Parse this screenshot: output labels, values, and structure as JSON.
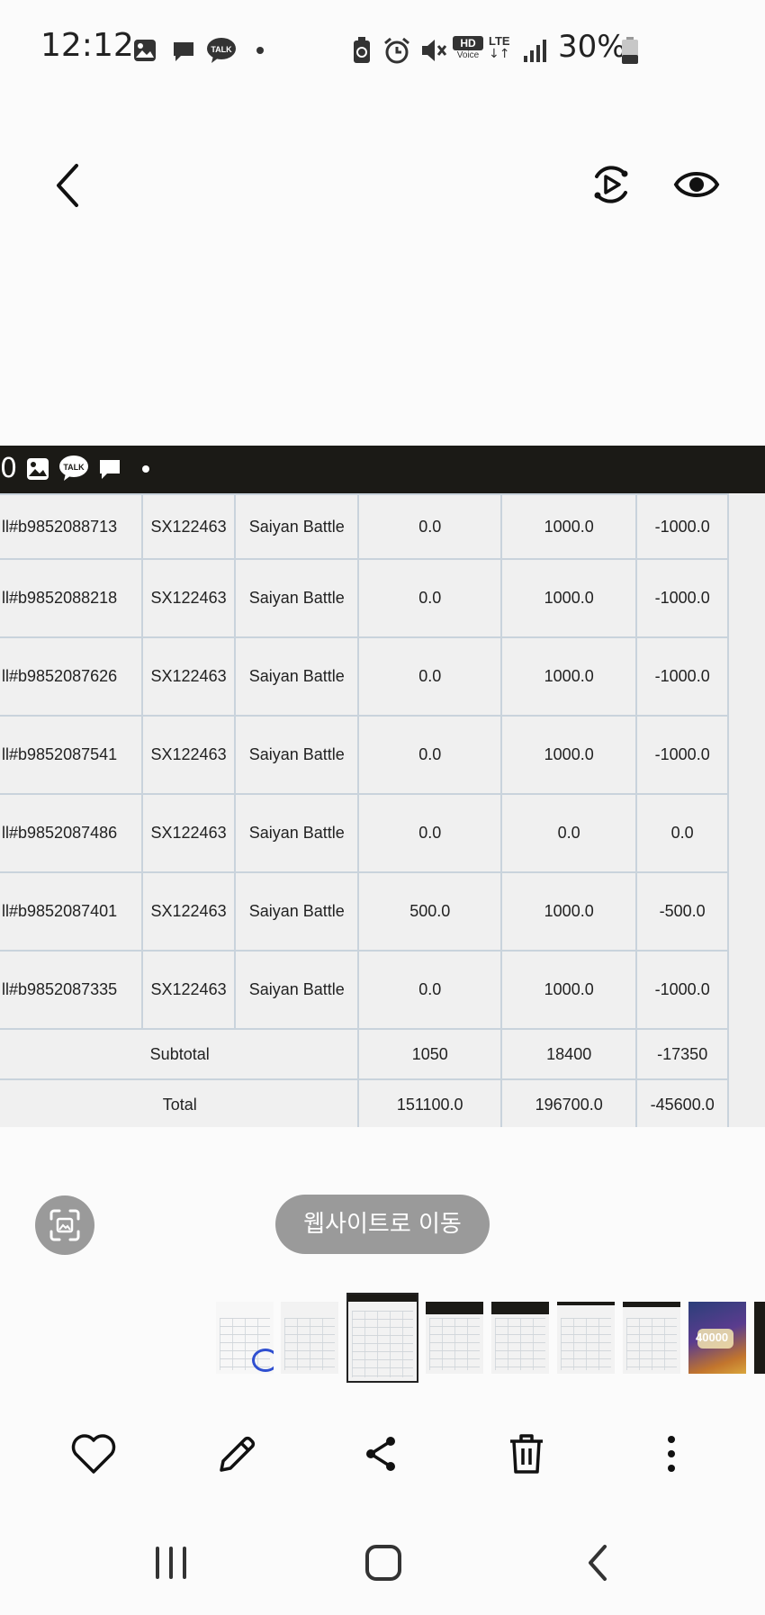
{
  "status_bar": {
    "time": "12:12",
    "battery": "30%",
    "hd_label": "HD",
    "voice_label": "Voice",
    "lte_label": "LTE"
  },
  "screenshot": {
    "status_text": "0",
    "rows": [
      {
        "id": "ll#b9852088713",
        "code": "SX122463",
        "game": "Saiyan Battle",
        "a": "0.0",
        "b": "1000.0",
        "c": "-1000.0"
      },
      {
        "id": "ll#b9852088218",
        "code": "SX122463",
        "game": "Saiyan Battle",
        "a": "0.0",
        "b": "1000.0",
        "c": "-1000.0"
      },
      {
        "id": "ll#b9852087626",
        "code": "SX122463",
        "game": "Saiyan Battle",
        "a": "0.0",
        "b": "1000.0",
        "c": "-1000.0"
      },
      {
        "id": "ll#b9852087541",
        "code": "SX122463",
        "game": "Saiyan Battle",
        "a": "0.0",
        "b": "1000.0",
        "c": "-1000.0"
      },
      {
        "id": "ll#b9852087486",
        "code": "SX122463",
        "game": "Saiyan Battle",
        "a": "0.0",
        "b": "0.0",
        "c": "0.0"
      },
      {
        "id": "ll#b9852087401",
        "code": "SX122463",
        "game": "Saiyan Battle",
        "a": "500.0",
        "b": "1000.0",
        "c": "-500.0"
      },
      {
        "id": "ll#b9852087335",
        "code": "SX122463",
        "game": "Saiyan Battle",
        "a": "0.0",
        "b": "1000.0",
        "c": "-1000.0"
      }
    ],
    "subtotal": {
      "label": "Subtotal",
      "a": "1050",
      "b": "18400",
      "c": "-17350"
    },
    "total": {
      "label": "Total",
      "a": "151100.0",
      "b": "196700.0",
      "c": "-45600.0"
    }
  },
  "overlay": {
    "website_button": "웹사이트로 이동"
  },
  "thumbnail_game_text": "40000"
}
